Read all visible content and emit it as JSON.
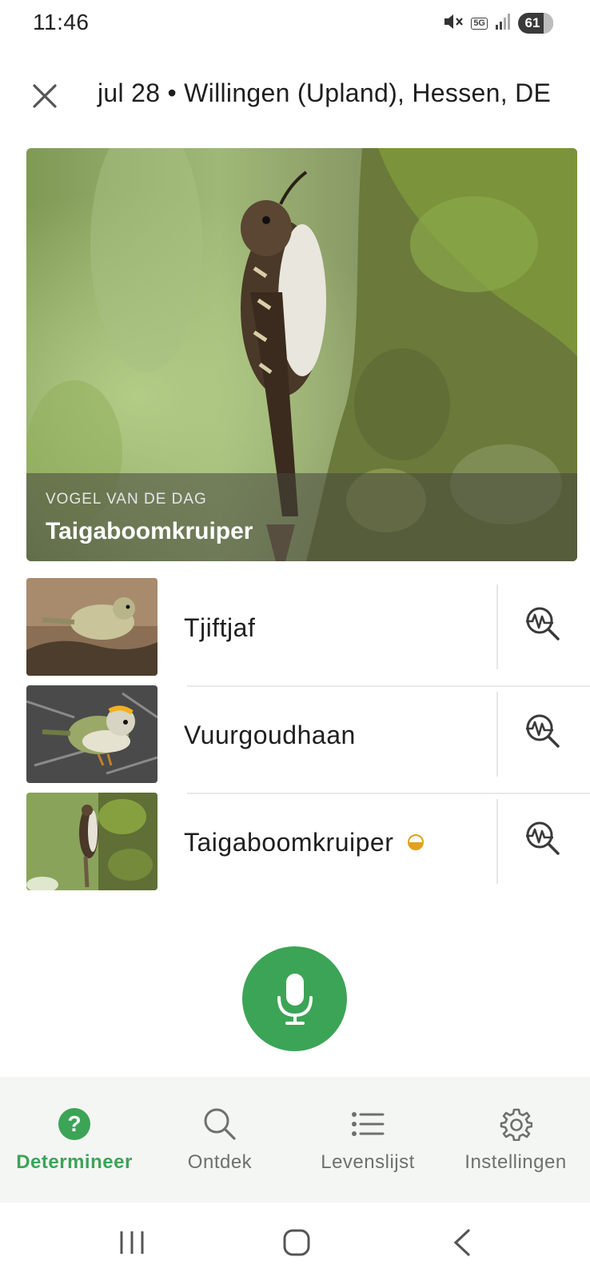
{
  "status_bar": {
    "time": "11:46",
    "network": "5G",
    "battery": "61"
  },
  "header": {
    "title": "jul 28 • Willingen (Upland), Hessen, DE"
  },
  "hero": {
    "kicker": "VOGEL VAN DE DAG",
    "title": "Taigaboomkruiper"
  },
  "list": [
    {
      "name": "Tjiftjaf",
      "badge": false
    },
    {
      "name": "Vuurgoudhaan",
      "badge": false
    },
    {
      "name": "Taigaboomkruiper",
      "badge": true
    }
  ],
  "bottom_nav": {
    "items": [
      {
        "label": "Determineer",
        "icon": "help-icon",
        "active": true
      },
      {
        "label": "Ontdek",
        "icon": "search-icon",
        "active": false
      },
      {
        "label": "Levenslijst",
        "icon": "list-icon",
        "active": false
      },
      {
        "label": "Instellingen",
        "icon": "gear-icon",
        "active": false
      }
    ]
  },
  "colors": {
    "accent": "#3ca456",
    "badge": "#e0a21a",
    "nav_background": "#f4f6f4"
  }
}
